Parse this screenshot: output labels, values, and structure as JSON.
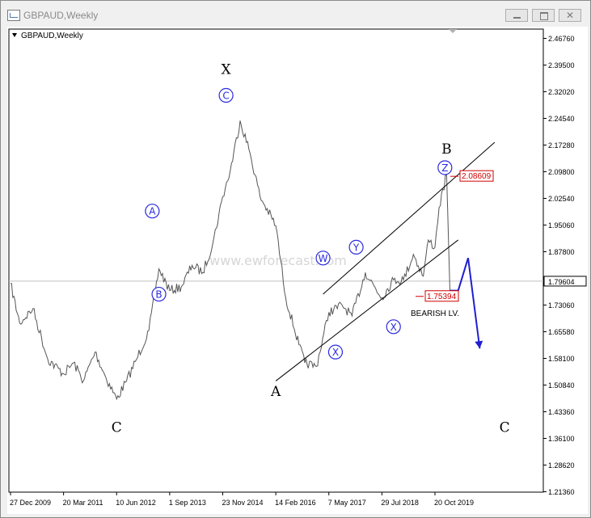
{
  "window": {
    "title": "GBPAUD,Weekly",
    "icon": "chart-window-icon",
    "buttons": {
      "minimize": "minimize-icon",
      "maximize": "maximize-icon",
      "close": "close-icon"
    }
  },
  "chart_data": {
    "type": "line",
    "title": "GBPAUD,Weekly",
    "watermark": "www.ewforecast.com",
    "x_labels": [
      "27 Dec 2009",
      "20 Mar 2011",
      "10 Jun 2012",
      "1 Sep 2013",
      "23 Nov 2014",
      "14 Feb 2016",
      "7 May 2017",
      "29 Jul 2018",
      "20 Oct 2019"
    ],
    "y_ticks": [
      "2.46760",
      "2.39500",
      "2.32020",
      "2.24540",
      "2.17280",
      "2.09800",
      "2.02540",
      "1.95060",
      "1.87800",
      "1.80320",
      "1.73060",
      "1.65580",
      "1.58100",
      "1.50840",
      "1.43360",
      "1.36100",
      "1.28620",
      "1.21360"
    ],
    "ylim": [
      1.2136,
      2.4676
    ],
    "grid": false,
    "current_price": "1.79604",
    "price_marks": [
      "2.08609",
      "1.75394"
    ],
    "series": [
      {
        "x": [
          "2009-12-27",
          "2010-03-14",
          "2010-07-04",
          "2010-11-07",
          "2011-03-20",
          "2011-06-12",
          "2011-09-04",
          "2011-12-11",
          "2012-03-11",
          "2012-06-10",
          "2012-09-02",
          "2012-11-25",
          "2013-03-10",
          "2013-06-02",
          "2013-09-01",
          "2013-12-08",
          "2014-03-09",
          "2014-06-08",
          "2014-08-31",
          "2014-11-23",
          "2015-01-25",
          "2015-04-19",
          "2015-07-12",
          "2015-10-04",
          "2016-02-14",
          "2016-05-08",
          "2016-08-28",
          "2016-10-16",
          "2017-01-22",
          "2017-05-07",
          "2017-08-27",
          "2017-11-19",
          "2018-03-11",
          "2018-07-29",
          "2018-11-04",
          "2019-01-27",
          "2019-04-21",
          "2019-07-14",
          "2019-08-25",
          "2019-10-20",
          "2019-11-24",
          "2020-01-26",
          "2020-02-23"
        ],
        "y": [
          1.79,
          1.68,
          1.72,
          1.58,
          1.54,
          1.57,
          1.52,
          1.6,
          1.53,
          1.47,
          1.52,
          1.58,
          1.66,
          1.83,
          1.77,
          1.78,
          1.84,
          1.82,
          1.9,
          2.03,
          2.1,
          2.24,
          2.15,
          2.03,
          1.95,
          1.75,
          1.62,
          1.57,
          1.56,
          1.71,
          1.73,
          1.7,
          1.82,
          1.75,
          1.8,
          1.8,
          1.87,
          1.81,
          1.91,
          1.89,
          2.0,
          2.09,
          1.77
        ]
      }
    ],
    "projection": {
      "x": [
        "2020-02-23",
        "2020-05-03",
        "2020-07-26",
        "2020-11-01"
      ],
      "y": [
        1.77,
        1.77,
        1.86,
        1.61
      ]
    },
    "channel": [
      {
        "name": "upper",
        "x": [
          "2017-03-19",
          "2021-03-07"
        ],
        "y": [
          1.76,
          2.18
        ]
      },
      {
        "name": "lower",
        "x": [
          "2016-02-14",
          "2020-05-03"
        ],
        "y": [
          1.52,
          1.91
        ]
      }
    ],
    "wave_labels": [
      {
        "label": "X",
        "x": "2014-12-21",
        "y": 2.38,
        "style": "black"
      },
      {
        "label": "C",
        "x": "2014-12-21",
        "y": 2.31,
        "style": "circled"
      },
      {
        "label": "A",
        "x": "2013-04-07",
        "y": 1.99,
        "style": "circled"
      },
      {
        "label": "B",
        "x": "2013-06-02",
        "y": 1.76,
        "style": "circled"
      },
      {
        "label": "C",
        "x": "2012-06-10",
        "y": 1.39,
        "style": "black"
      },
      {
        "label": "A",
        "x": "2016-02-14",
        "y": 1.49,
        "style": "black"
      },
      {
        "label": "W",
        "x": "2017-03-19",
        "y": 1.86,
        "style": "circled"
      },
      {
        "label": "X",
        "x": "2017-07-02",
        "y": 1.6,
        "style": "circled"
      },
      {
        "label": "Y",
        "x": "2017-12-24",
        "y": 1.89,
        "style": "circled"
      },
      {
        "label": "X",
        "x": "2018-11-04",
        "y": 1.67,
        "style": "circled"
      },
      {
        "label": "B",
        "x": "2020-01-26",
        "y": 2.16,
        "style": "black"
      },
      {
        "label": "Z",
        "x": "2020-01-12",
        "y": 2.11,
        "style": "circled"
      },
      {
        "label": "C",
        "x": "2021-05-30",
        "y": 1.39,
        "style": "black"
      }
    ],
    "annotations": [
      "BEARISH LV."
    ]
  }
}
